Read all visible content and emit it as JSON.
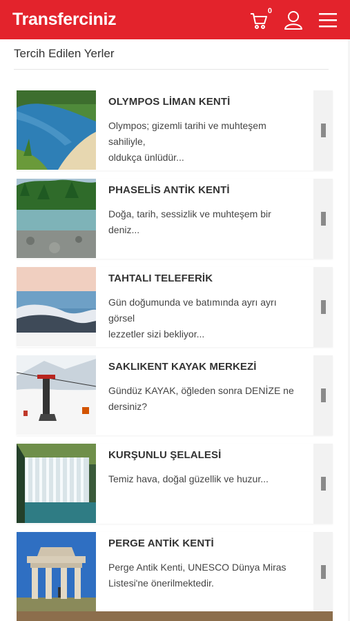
{
  "header": {
    "logo": "Transferciniz",
    "cart_count": "0",
    "icons": [
      "cart-icon",
      "user-icon",
      "menu-icon"
    ],
    "bg_color": "#e3232c"
  },
  "section": {
    "title": "Tercih Edilen Yerler"
  },
  "places": [
    {
      "title": "OLYMPOS LİMAN KENTİ",
      "desc_lines": [
        "Olympos; gizemli tarihi ve muhteşem sahiliyle,",
        "oldukça ünlüdür..."
      ],
      "image": "olympos-beach-image"
    },
    {
      "title": "PHASELİS ANTİK KENTİ",
      "desc_lines": [
        "Doğa, tarih, sessizlik ve muhteşem bir deniz...",
        ""
      ],
      "image": "phaselis-coast-image"
    },
    {
      "title": "TAHTALI TELEFERİK",
      "desc_lines": [
        "Gün doğumunda ve batımında ayrı ayrı görsel",
        "lezzetler sizi bekliyor..."
      ],
      "image": "tahtali-mountain-image"
    },
    {
      "title": "SAKLIKENT KAYAK MERKEZİ",
      "desc_lines": [
        "Gündüz KAYAK, öğleden sonra DENİZE ne",
        "dersiniz?"
      ],
      "image": "saklikent-ski-lift-image"
    },
    {
      "title": "KURŞUNLU ŞELALESİ",
      "desc_lines": [
        "Temiz hava, doğal güzellik ve huzur...",
        ""
      ],
      "image": "kursunlu-waterfall-image"
    },
    {
      "title": "PERGE ANTİK KENTİ",
      "desc_lines": [
        "Perge Antik Kenti, UNESCO Dünya Miras",
        "Listesi'ne önerilmektedir."
      ],
      "image": "perge-ruins-image"
    }
  ]
}
